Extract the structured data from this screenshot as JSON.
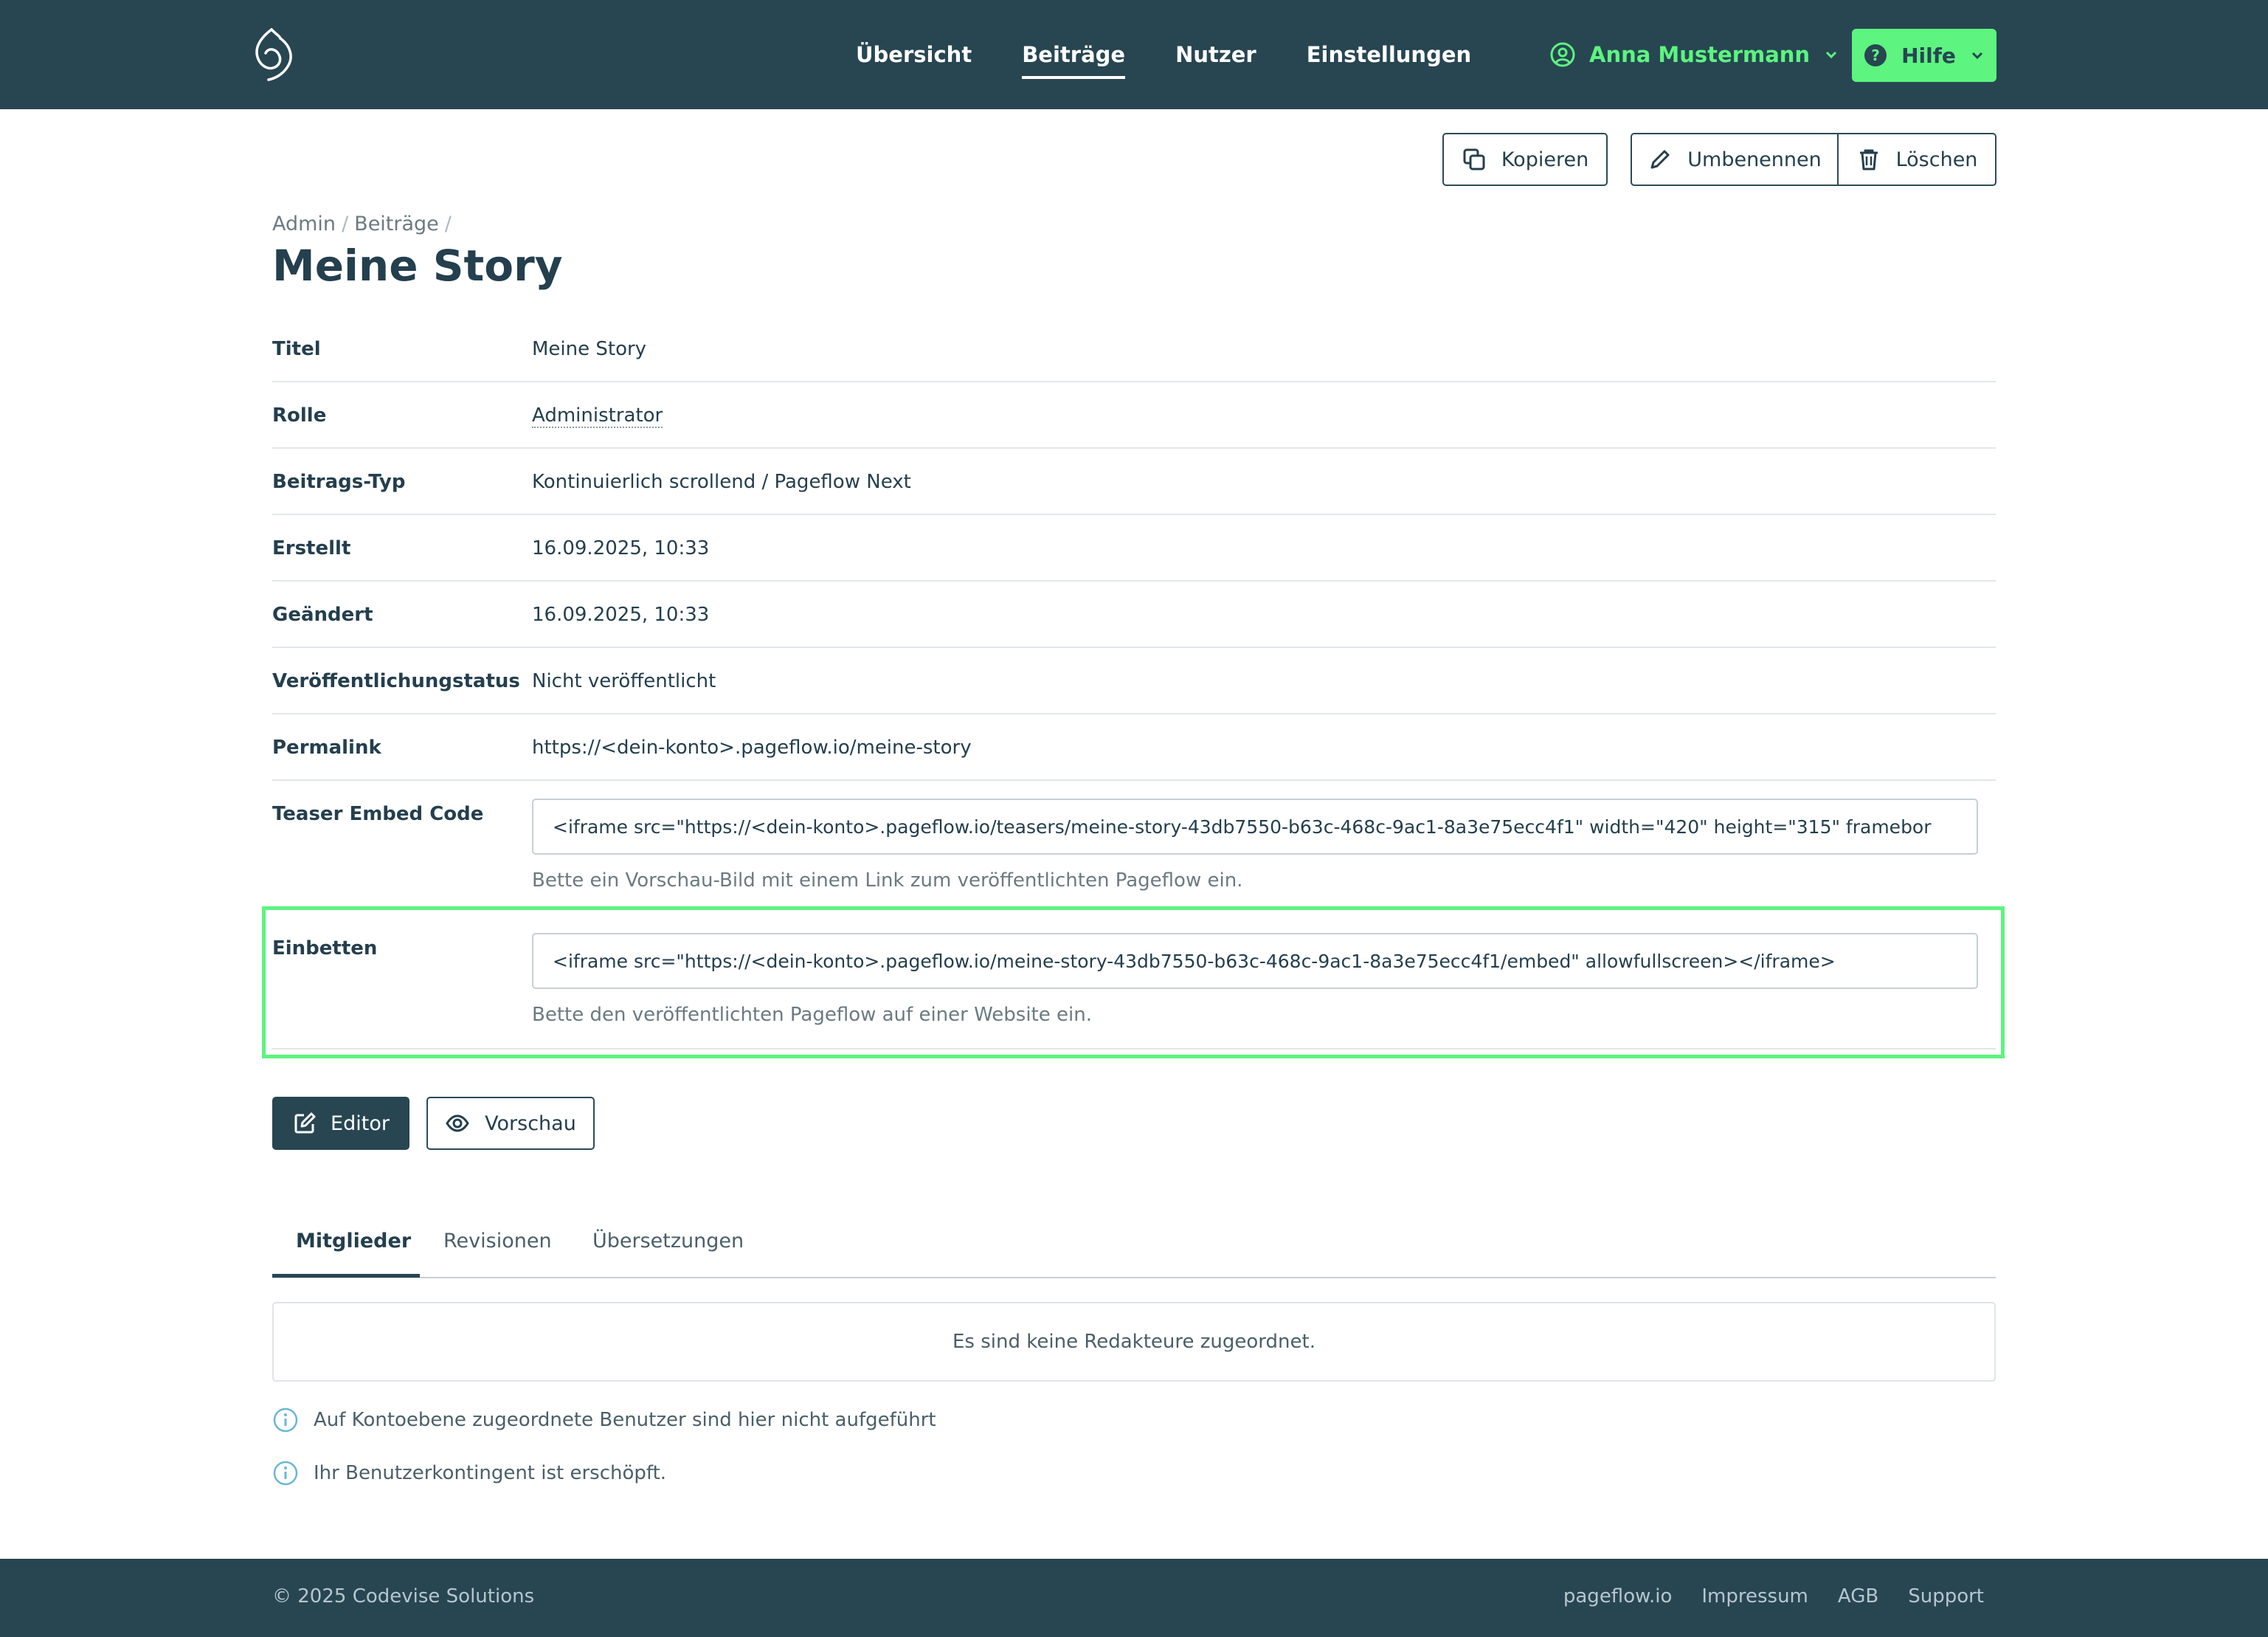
{
  "nav": {
    "items": [
      {
        "label": "Übersicht",
        "active": false
      },
      {
        "label": "Beiträge",
        "active": true
      },
      {
        "label": "Nutzer",
        "active": false
      },
      {
        "label": "Einstellungen",
        "active": false
      }
    ],
    "user_name": "Anna Mustermann",
    "help_label": "Hilfe"
  },
  "actions": {
    "copy_label": "Kopieren",
    "rename_label": "Umbenennen",
    "delete_label": "Löschen"
  },
  "breadcrumb": [
    "Admin",
    "Beiträge"
  ],
  "page_title": "Meine Story",
  "details": {
    "title": {
      "label": "Titel",
      "value": "Meine Story"
    },
    "role": {
      "label": "Rolle",
      "value": "Administrator"
    },
    "type": {
      "label": "Beitrags-Typ",
      "value": "Kontinuierlich scrollend / Pageflow Next"
    },
    "created": {
      "label": "Erstellt",
      "value": "16.09.2025, 10:33"
    },
    "changed": {
      "label": "Geändert",
      "value": "16.09.2025, 10:33"
    },
    "status": {
      "label": "Veröffentlichungstatus",
      "value": "Nicht veröffentlicht"
    },
    "permalink": {
      "label": "Permalink",
      "value": "https://<dein-konto>.pageflow.io/meine-story"
    },
    "teaser": {
      "label": "Teaser Embed Code",
      "value": "<iframe src=\"https://<dein-konto>.pageflow.io/teasers/meine-story-43db7550-b63c-468c-9ac1-8a3e75ecc4f1\" width=\"420\" height=\"315\" framebor",
      "hint": "Bette ein Vorschau-Bild mit einem Link zum veröffentlichten Pageflow ein."
    },
    "embed": {
      "label": "Einbetten",
      "value": "<iframe src=\"https://<dein-konto>.pageflow.io/meine-story-43db7550-b63c-468c-9ac1-8a3e75ecc4f1/embed\" allowfullscreen></iframe>",
      "hint": "Bette den veröffentlichten Pageflow auf einer Website ein."
    }
  },
  "buttons": {
    "editor_label": "Editor",
    "preview_label": "Vorschau"
  },
  "tabs": [
    {
      "label": "Mitglieder",
      "active": true
    },
    {
      "label": "Revisionen",
      "active": false
    },
    {
      "label": "Übersetzungen",
      "active": false
    }
  ],
  "members": {
    "empty_text": "Es sind keine Redakteure zugeordnet.",
    "info_1": "Auf Kontoebene zugeordnete Benutzer sind hier nicht aufgeführt",
    "info_2": "Ihr Benutzerkontingent ist erschöpft."
  },
  "footer": {
    "copyright": "© 2025 Codevise Solutions",
    "links": [
      "pageflow.io",
      "Impressum",
      "AGB",
      "Support"
    ]
  },
  "colors": {
    "header_bg": "#274652",
    "accent": "#5df47f",
    "text": "#243f4e"
  }
}
